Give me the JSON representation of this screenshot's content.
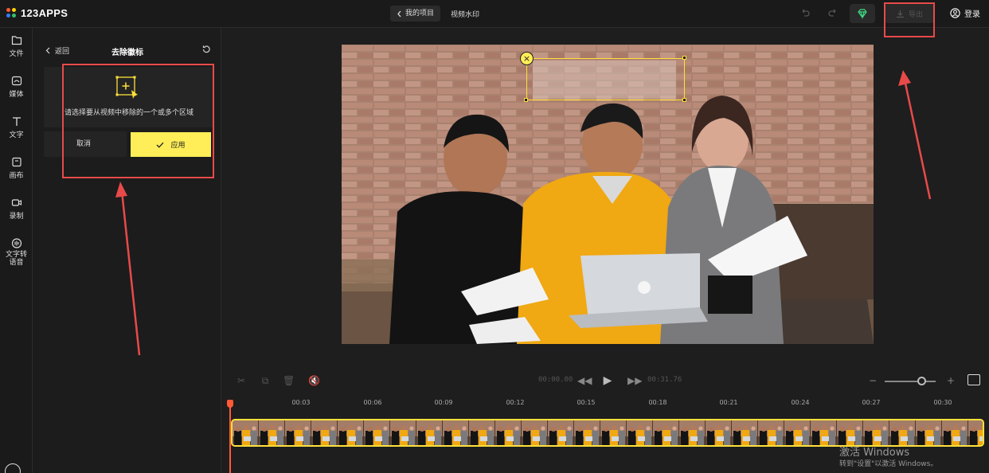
{
  "app": {
    "logo_text": "123APPS",
    "logo_colors": [
      "#ff5a36",
      "#ffd500",
      "#2f80ff",
      "#32c36c"
    ]
  },
  "header": {
    "projects_label": "我的项目",
    "project_name": "视频水印",
    "export_label": "导出",
    "login_label": "登录"
  },
  "rail": {
    "items": [
      {
        "label": "文件",
        "icon": "folder-icon"
      },
      {
        "label": "媒体",
        "icon": "media-icon"
      },
      {
        "label": "文字",
        "icon": "text-icon"
      },
      {
        "label": "画布",
        "icon": "canvas-icon"
      },
      {
        "label": "录制",
        "icon": "record-icon"
      },
      {
        "label": "文字转\n语音",
        "line1": "文字转",
        "line2": "语音",
        "icon": "tts-icon"
      }
    ]
  },
  "panel": {
    "back_label": "返回",
    "title": "去除徽标",
    "hint": "请选择要从视频中移除的一个或多个区域",
    "cancel_label": "取消",
    "apply_label": "应用"
  },
  "player": {
    "current_time": "00:00.00",
    "duration": "00:31.76"
  },
  "timeline": {
    "ticks": [
      "00:03",
      "00:06",
      "00:09",
      "00:12",
      "00:15",
      "00:18",
      "00:21",
      "00:24",
      "00:27",
      "00:30"
    ],
    "playhead_position": 0
  },
  "os_watermark": {
    "title": "激活 Windows",
    "subtitle": "转到\"设置\"以激活 Windows。"
  },
  "colors": {
    "accent": "#ffee57",
    "annotation": "#e84a4a",
    "playhead": "#ff5a36"
  }
}
